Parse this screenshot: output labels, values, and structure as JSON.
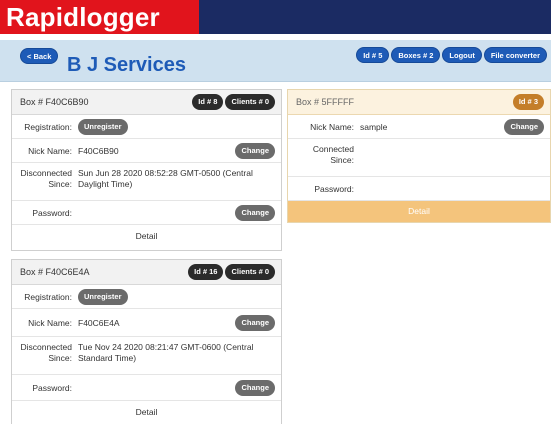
{
  "brand": {
    "logo_text": "Rapidlogger"
  },
  "header": {
    "back_label": "< Back",
    "title": "B J Services",
    "nav": [
      {
        "label": "Id # 5"
      },
      {
        "label": "Boxes # 2"
      },
      {
        "label": "Logout"
      },
      {
        "label": "File converter"
      }
    ]
  },
  "labels": {
    "registration": "Registration:",
    "nick_name": "Nick Name:",
    "disconnected_1": "Disconnected",
    "disconnected_2": "Since:",
    "connected_1": "Connected",
    "connected_2": "Since:",
    "password": "Password:",
    "unregister": "Unregister",
    "change": "Change",
    "detail": "Detail"
  },
  "boxes": [
    {
      "title": "Box # F40C6B90",
      "id_badge": "Id # 8",
      "clients_badge": "Clients # 0",
      "nick_name": "F40C6B90",
      "disconnected_line1": "Sun Jun 28 2020 08:52:28 GMT-0500 (Central",
      "disconnected_line2": "Daylight Time)"
    },
    {
      "title": "Box # F40C6E4A",
      "id_badge": "Id # 16",
      "clients_badge": "Clients # 0",
      "nick_name": "F40C6E4A",
      "disconnected_line1": "Tue Nov 24 2020 08:21:47 GMT-0600 (Central",
      "disconnected_line2": "Standard Time)"
    },
    {
      "title": "Box # 5FFFFF",
      "id_badge": "Id # 3",
      "nick_name": "sample",
      "connected_since": "",
      "password": ""
    }
  ],
  "colors": {
    "brand_red": "#e1141c",
    "top_bar": "#1b2b63",
    "header_band": "#cfe1ef",
    "accent_blue": "#1e5bb7",
    "detail_orange": "#f4c47c"
  }
}
